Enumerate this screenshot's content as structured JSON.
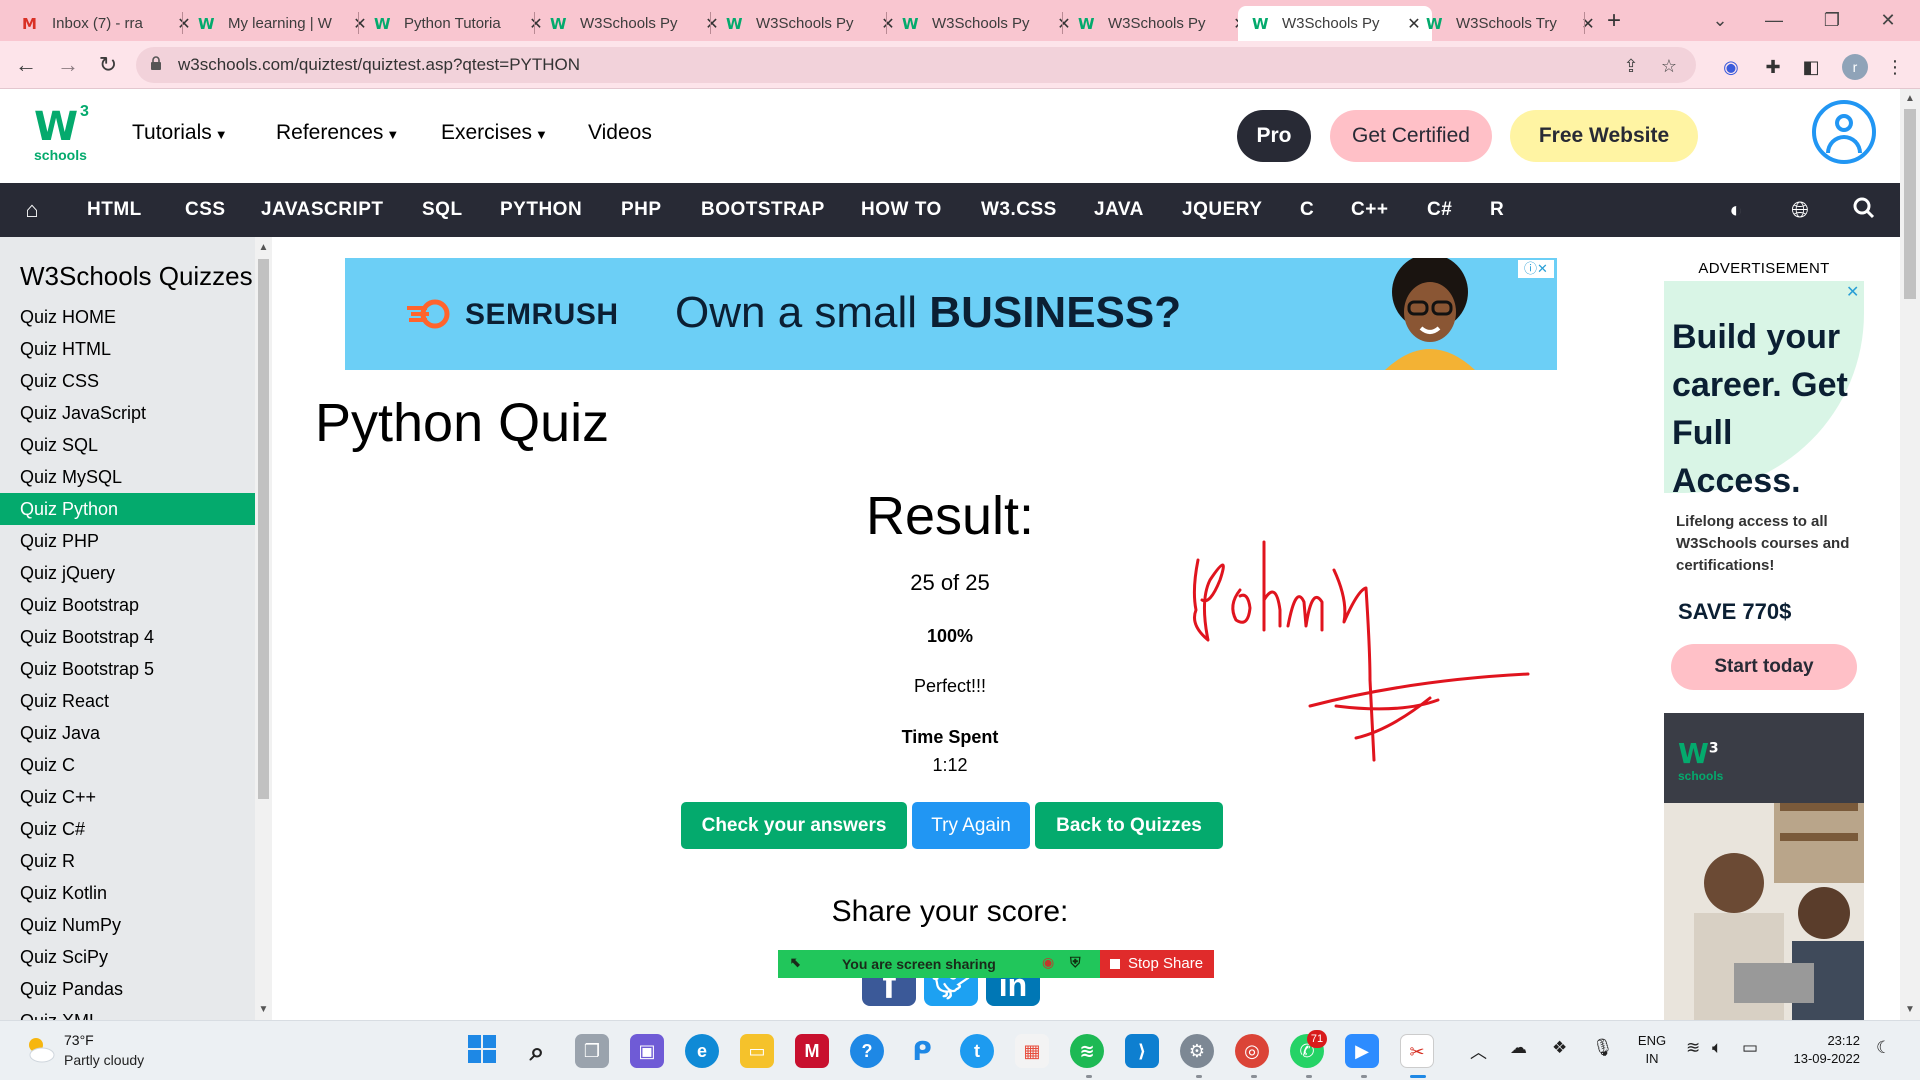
{
  "browser": {
    "tabs": [
      {
        "icon": "gmail-icon",
        "title": "Inbox (7) - rra"
      },
      {
        "icon": "w3schools-favicon",
        "title": "My learning | W"
      },
      {
        "icon": "w3schools-favicon",
        "title": "Python Tutoria"
      },
      {
        "icon": "w3schools-favicon",
        "title": "W3Schools Py"
      },
      {
        "icon": "w3schools-favicon",
        "title": "W3Schools Py"
      },
      {
        "icon": "w3schools-favicon",
        "title": "W3Schools Py"
      },
      {
        "icon": "w3schools-favicon",
        "title": "W3Schools Py"
      },
      {
        "icon": "w3schools-favicon",
        "title": "W3Schools Py",
        "active": true
      },
      {
        "icon": "w3schools-favicon",
        "title": "W3Schools Try"
      }
    ],
    "url": "w3schools.com/quiztest/quiztest.asp?qtest=PYTHON",
    "profile_initial": "r"
  },
  "header": {
    "logo_text": "schools",
    "logo_sup": "3",
    "menu": [
      {
        "label": "Tutorials",
        "has_caret": true
      },
      {
        "label": "References",
        "has_caret": true
      },
      {
        "label": "Exercises",
        "has_caret": true
      },
      {
        "label": "Videos",
        "has_caret": false
      }
    ],
    "pro_label": "Pro",
    "cert_label": "Get Certified",
    "free_label": "Free Website"
  },
  "topnav": {
    "items": [
      "HTML",
      "CSS",
      "JAVASCRIPT",
      "SQL",
      "PYTHON",
      "PHP",
      "BOOTSTRAP",
      "HOW TO",
      "W3.CSS",
      "JAVA",
      "JQUERY",
      "C",
      "C++",
      "C#",
      "R"
    ]
  },
  "sidebar": {
    "title": "W3Schools Quizzes",
    "items": [
      {
        "label": "Quiz HOME"
      },
      {
        "label": "Quiz HTML"
      },
      {
        "label": "Quiz CSS"
      },
      {
        "label": "Quiz JavaScript"
      },
      {
        "label": "Quiz SQL"
      },
      {
        "label": "Quiz MySQL"
      },
      {
        "label": "Quiz Python",
        "active": true
      },
      {
        "label": "Quiz PHP"
      },
      {
        "label": "Quiz jQuery"
      },
      {
        "label": "Quiz Bootstrap"
      },
      {
        "label": "Quiz Bootstrap 4"
      },
      {
        "label": "Quiz Bootstrap 5"
      },
      {
        "label": "Quiz React"
      },
      {
        "label": "Quiz Java"
      },
      {
        "label": "Quiz C"
      },
      {
        "label": "Quiz C++"
      },
      {
        "label": "Quiz C#"
      },
      {
        "label": "Quiz R"
      },
      {
        "label": "Quiz Kotlin"
      },
      {
        "label": "Quiz NumPy"
      },
      {
        "label": "Quiz SciPy"
      },
      {
        "label": "Quiz Pandas"
      },
      {
        "label": "Quiz XML"
      }
    ]
  },
  "banner_ad": {
    "brand": "SEMRUSH",
    "headline_prefix": "Own a small ",
    "headline_bold": "BUSINESS?"
  },
  "main": {
    "page_title": "Python Quiz",
    "result_heading": "Result:",
    "score": "25 of 25",
    "percent": "100%",
    "verdict": "Perfect!!!",
    "time_label": "Time Spent",
    "time_value": "1:12",
    "buttons": {
      "check": "Check your answers",
      "try_again": "Try Again",
      "back": "Back to Quizzes"
    },
    "share_heading": "Share your score:"
  },
  "screen_share": {
    "status": "You are screen sharing",
    "stop_label": "Stop Share"
  },
  "right_ad": {
    "label": "ADVERTISEMENT",
    "headline": "Build your career. Get Full Access.",
    "subtext": "Lifelong access to all W3Schools courses and certifications!",
    "save": "SAVE 770$",
    "cta": "Start today",
    "photo_logo_sup": "3",
    "photo_logo_text": "schools"
  },
  "taskbar": {
    "temperature": "73°F",
    "weather": "Partly cloudy",
    "whatsapp_badge": "71",
    "lang_line1": "ENG",
    "lang_line2": "IN",
    "time": "23:12",
    "date": "13-09-2022"
  },
  "colors": {
    "w3_green": "#04AA6D",
    "nav_dark": "#282A35",
    "sidebar_bg": "#E7E9EB",
    "try_again_blue": "#2196F3",
    "cert_pink": "#FFC0C7",
    "free_yellow": "#FFF4A3",
    "signature_red": "#e0141e"
  }
}
